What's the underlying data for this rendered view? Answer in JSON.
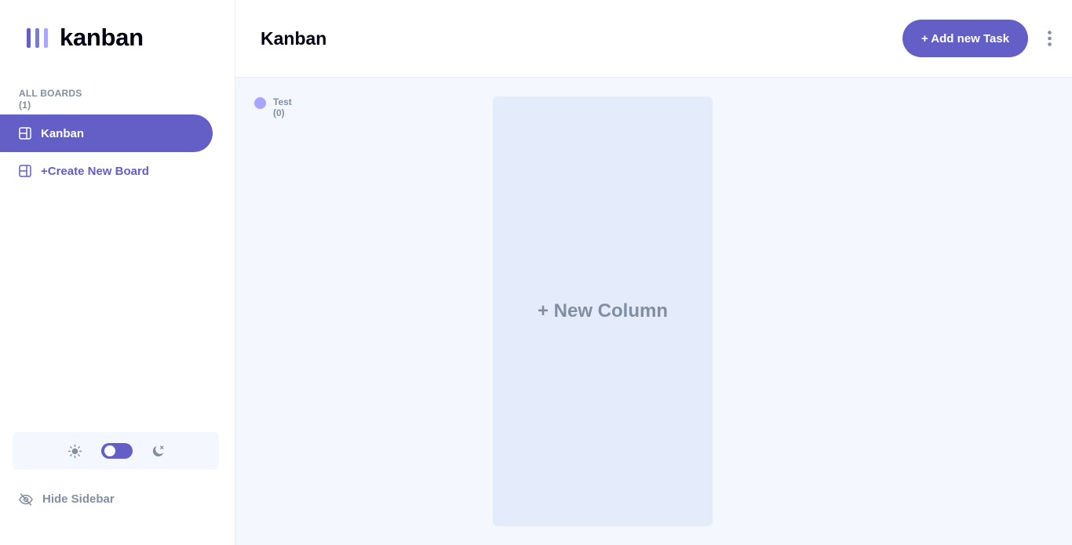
{
  "app": {
    "logo_text": "kanban"
  },
  "sidebar": {
    "all_boards_label": "ALL BOARDS",
    "board_count": "(1)",
    "boards": [
      {
        "label": "Kanban",
        "active": true
      }
    ],
    "create_board_label": "+Create New Board",
    "hide_sidebar_label": "Hide Sidebar",
    "theme": {
      "light_icon": "sun-icon",
      "dark_icon": "moon-icon",
      "mode": "light"
    }
  },
  "header": {
    "board_title": "Kanban",
    "add_task_label": "+ Add new Task",
    "more_icon": "vertical-ellipsis-icon"
  },
  "board": {
    "columns": [
      {
        "name": "Test",
        "count": "(0)",
        "dot_color": "#a8a4ff"
      }
    ],
    "new_column_label": "+ New Column"
  },
  "colors": {
    "accent": "#635fc7",
    "accent_light": "#a8a4ff",
    "muted_text": "#828fa3",
    "board_bg": "#f4f7fd",
    "lines": "#e4ebfa"
  }
}
